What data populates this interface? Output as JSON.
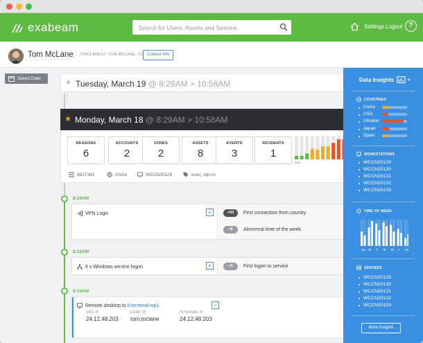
{
  "app": {
    "brand": "exabeam"
  },
  "search": {
    "placeholder": "Search for Users, Assets and Sesions"
  },
  "nav": {
    "settings": "Settings",
    "logout": "Logout",
    "help": "?"
  },
  "user": {
    "name": "Tom McLane",
    "aliases": "(TMCLANE02, TOM.MCLANE, TOMMC)",
    "contact_label": "Contact Info"
  },
  "select_date_label": "Select Date",
  "day1": {
    "date": "Tuesday, March 19",
    "time_range": "@ 8:29AM > 10:58AM"
  },
  "day2": {
    "date": "Monday, March 18",
    "time_range": "@ 8:29AM > 10:58AM"
  },
  "stats": [
    {
      "label": "REASONS",
      "value": "6"
    },
    {
      "label": "ACCOUNTS",
      "value": "2"
    },
    {
      "label": "ZONES",
      "value": "2"
    },
    {
      "label": "ASSETS",
      "value": "8"
    },
    {
      "label": "EVENTS",
      "value": "3"
    },
    {
      "label": "INCIDENTS",
      "value": "1"
    }
  ],
  "minichart": {
    "label": "8AM",
    "levels": [
      0.15,
      0.15,
      0.25,
      0.45,
      0.4,
      0.55,
      0.55,
      0.7,
      0.85,
      0.85
    ],
    "colors": [
      "#5dbb43",
      "#5dbb43",
      "#5dbb43",
      "#f5a623",
      "#f5a623",
      "#f5a623",
      "#f5a623",
      "#e8542a",
      "#e8542a",
      "#e8542a"
    ]
  },
  "meta": {
    "session_id": "8817361",
    "location": "China",
    "host": "WCCN20129",
    "tags": "exec, vpn-in"
  },
  "timeline": {
    "t1": "8:29AM",
    "t2": "8:32AM",
    "t3": "9:15AM"
  },
  "events": {
    "vpn": {
      "title": "VPN Login",
      "reasons": [
        {
          "score": "+50",
          "text": "First connection from country"
        },
        {
          "score": "+8",
          "text": "Abnormal time of the week"
        }
      ]
    },
    "winlogon": {
      "title": "8 x Windows service logon",
      "reasons": [
        {
          "score": "+5",
          "text": "First logon to service"
        }
      ]
    },
    "rdp": {
      "title_prefix": "Remote desktop to",
      "host": "li-terminal-wp1",
      "src_ip_label": "SRC IP",
      "src_ip": "24.12.48.203",
      "user_id_label": "USER ID",
      "user_id": "tom.mclane",
      "internal_ip_label": "INTERNAL IP",
      "internal_ip": "24.12.48.203"
    }
  },
  "insights": {
    "title": "Data Insights",
    "countries_title": "COUNTRIES",
    "countries": [
      {
        "name": "China",
        "fill": 0.3,
        "color": "#f5a623"
      },
      {
        "name": "USA",
        "fill": 0.25,
        "color": "#e8542a"
      },
      {
        "name": "Ukraine",
        "fill": 0.85,
        "color": "#e8542a"
      },
      {
        "name": "Japan",
        "fill": 0.3,
        "color": "#e8542a"
      },
      {
        "name": "Spain",
        "fill": 0.25,
        "color": "#f5a623"
      }
    ],
    "workstations_title": "WORKSTATIONS",
    "workstations": [
      "WCCN20129",
      "WCCN20130",
      "WCCN20131",
      "WCCN20132",
      "WCCN20133"
    ],
    "time_title": "TIME OF WEEK",
    "week_days": [
      "Su",
      "M",
      "T",
      "W",
      "Th",
      "F",
      "Sa"
    ],
    "week_levels": [
      [
        0.55,
        0.4
      ],
      [
        0.7,
        0.95
      ],
      [
        0.85,
        0.6
      ],
      [
        0.9,
        0.75
      ],
      [
        0.8,
        0.55
      ],
      [
        0.65,
        0.5
      ],
      [
        0.3,
        0.45
      ]
    ],
    "servers_title": "SERVERS",
    "servers": [
      "WCCN20129",
      "WCCN20130",
      "WCCN20131",
      "WCCN20132",
      "WCCN20133"
    ],
    "more_label": "More Insights"
  }
}
